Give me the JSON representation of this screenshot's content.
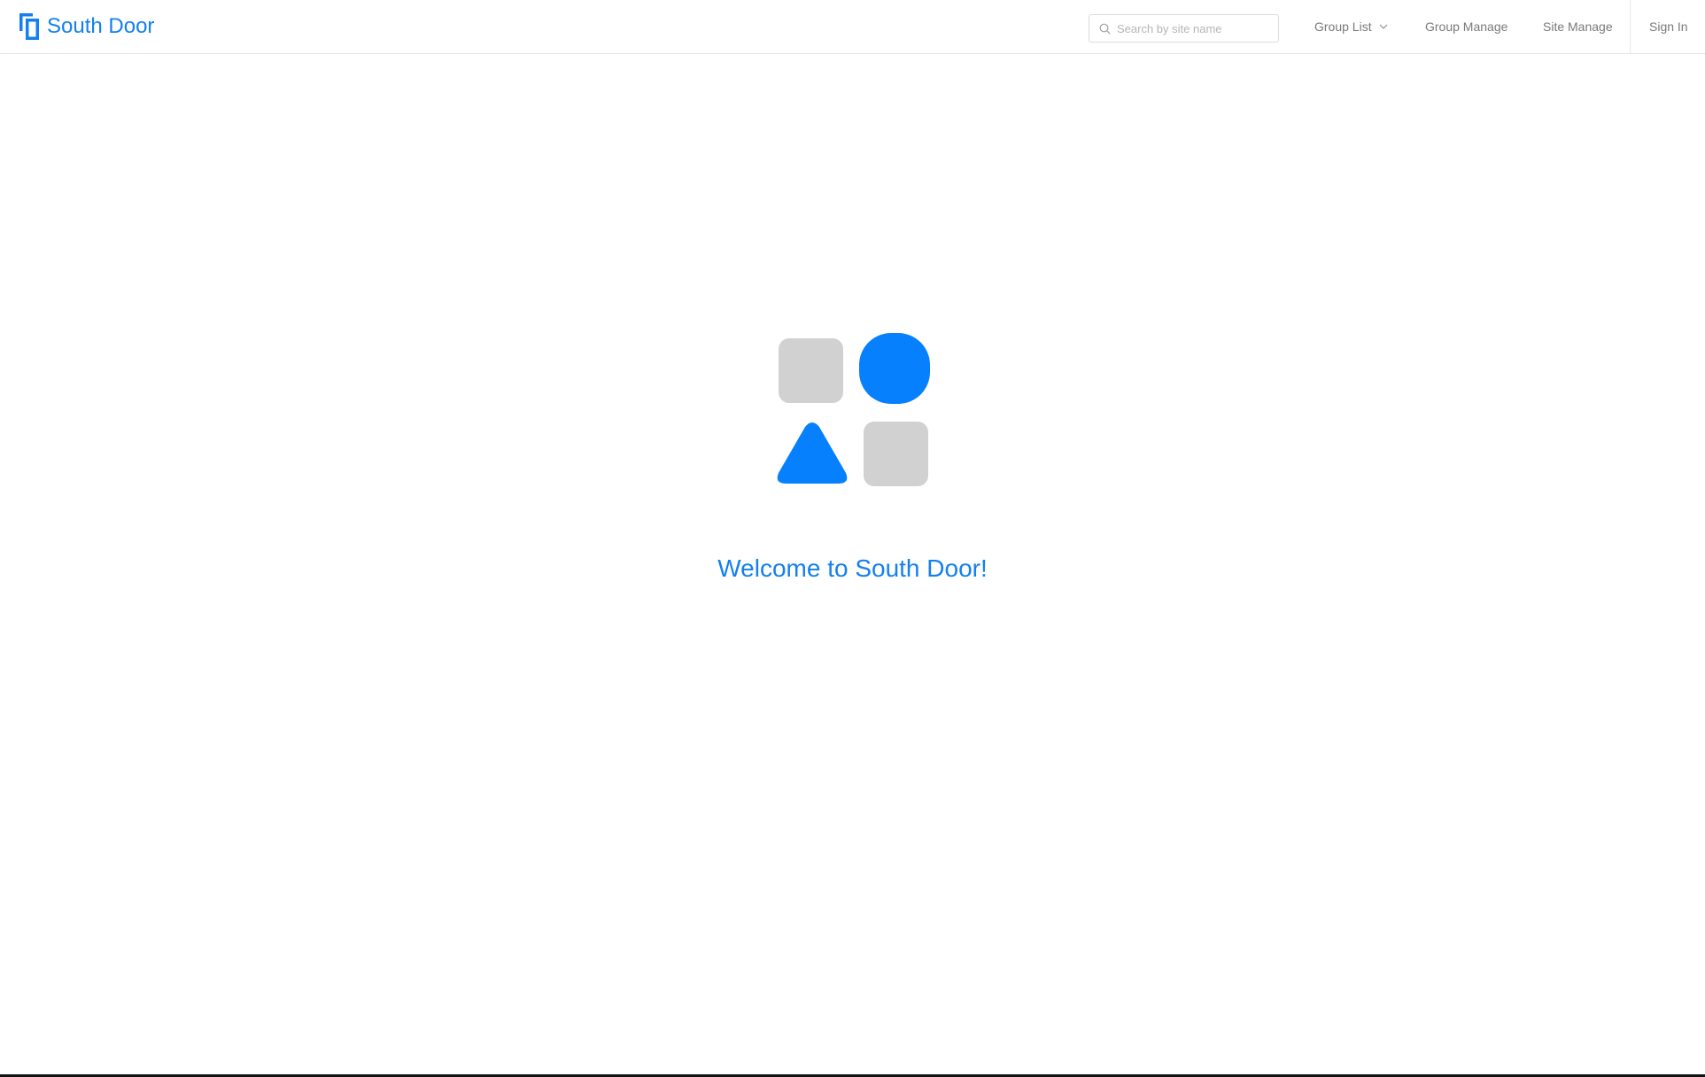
{
  "brand": {
    "name": "South Door",
    "color": "#1380f0"
  },
  "search": {
    "placeholder": "Search by site name",
    "value": "",
    "icon": "search-icon"
  },
  "nav": {
    "group_list": "Group List",
    "group_list_icon": "chevron-down-icon",
    "group_manage": "Group Manage",
    "site_manage": "Site Manage",
    "sign_in": "Sign In"
  },
  "hero": {
    "illustration": "shapes-illustration",
    "welcome_text": "Welcome to South Door!"
  },
  "colors": {
    "accent": "#0680fc",
    "muted_shape": "#d1d1d1",
    "nav_text": "#7a7a7a",
    "divider": "#e6e6e6"
  }
}
